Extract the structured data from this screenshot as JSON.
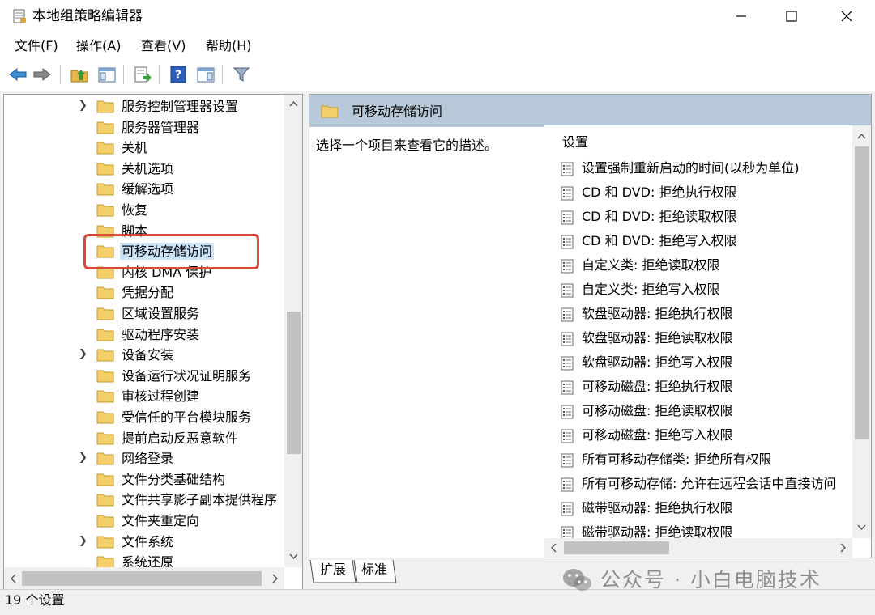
{
  "window": {
    "title": "本地组策略编辑器",
    "icon": "policy-editor-icon"
  },
  "menubar": {
    "items": [
      {
        "label": "文件(F)"
      },
      {
        "label": "操作(A)"
      },
      {
        "label": "查看(V)"
      },
      {
        "label": "帮助(H)"
      }
    ]
  },
  "toolbar": {
    "icons": [
      "back-arrow-icon",
      "forward-arrow-icon",
      "up-folder-icon",
      "show-hide-tree-icon",
      "export-list-icon",
      "help-icon",
      "properties-view-icon",
      "filter-icon"
    ]
  },
  "tree": {
    "items": [
      {
        "label": "服务控制管理器设置",
        "expandable": true
      },
      {
        "label": "服务器管理器",
        "expandable": false
      },
      {
        "label": "关机",
        "expandable": false
      },
      {
        "label": "关机选项",
        "expandable": false
      },
      {
        "label": "缓解选项",
        "expandable": false
      },
      {
        "label": "恢复",
        "expandable": false
      },
      {
        "label": "脚本",
        "expandable": false
      },
      {
        "label": "可移动存储访问",
        "expandable": false,
        "selected": true
      },
      {
        "label": "内核 DMA 保护",
        "expandable": false
      },
      {
        "label": "凭据分配",
        "expandable": false
      },
      {
        "label": "区域设置服务",
        "expandable": false
      },
      {
        "label": "驱动程序安装",
        "expandable": false
      },
      {
        "label": "设备安装",
        "expandable": true
      },
      {
        "label": "设备运行状况证明服务",
        "expandable": false
      },
      {
        "label": "审核过程创建",
        "expandable": false
      },
      {
        "label": "受信任的平台模块服务",
        "expandable": false
      },
      {
        "label": "提前启动反恶意软件",
        "expandable": false
      },
      {
        "label": "网络登录",
        "expandable": true
      },
      {
        "label": "文件分类基础结构",
        "expandable": false
      },
      {
        "label": "文件共享影子副本提供程序",
        "expandable": false
      },
      {
        "label": "文件夹重定向",
        "expandable": false
      },
      {
        "label": "文件系统",
        "expandable": true
      },
      {
        "label": "系统还原",
        "expandable": false
      }
    ]
  },
  "right_panel": {
    "header": "可移动存储访问",
    "description": "选择一个项目来查看它的描述。",
    "list_header": "设置",
    "settings": [
      "设置强制重新启动的时间(以秒为单位)",
      "CD 和 DVD: 拒绝执行权限",
      "CD 和 DVD: 拒绝读取权限",
      "CD 和 DVD: 拒绝写入权限",
      "自定义类: 拒绝读取权限",
      "自定义类: 拒绝写入权限",
      "软盘驱动器: 拒绝执行权限",
      "软盘驱动器: 拒绝读取权限",
      "软盘驱动器: 拒绝写入权限",
      "可移动磁盘: 拒绝执行权限",
      "可移动磁盘: 拒绝读取权限",
      "可移动磁盘: 拒绝写入权限",
      "所有可移动存储类: 拒绝所有权限",
      "所有可移动存储: 允许在远程会话中直接访问",
      "磁带驱动器: 拒绝执行权限",
      "磁带驱动器: 拒绝读取权限"
    ]
  },
  "tabs": [
    {
      "label": "扩展"
    },
    {
      "label": "标准"
    }
  ],
  "status": {
    "text": "19 个设置"
  },
  "watermark": {
    "text": "公众号 · 小白电脑技术",
    "icon": "wechat-icon"
  },
  "colors": {
    "header_bg": "#b8c9d9",
    "selection": "#cce4f7",
    "highlight_box": "#e04638",
    "folder": "#f3cf6a"
  }
}
